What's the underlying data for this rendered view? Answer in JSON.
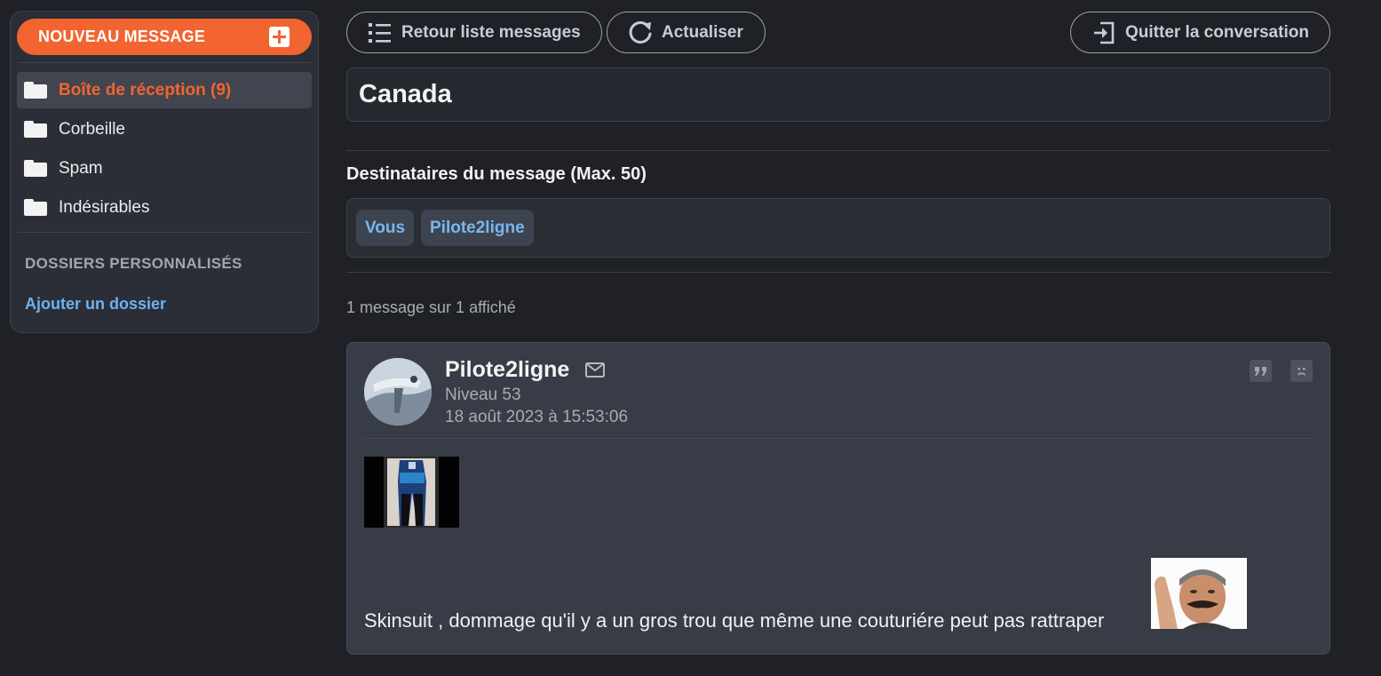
{
  "sidebar": {
    "new_message_label": "NOUVEAU MESSAGE",
    "folders": [
      {
        "label": "Boîte de réception (9)",
        "active": true
      },
      {
        "label": "Corbeille",
        "active": false
      },
      {
        "label": "Spam",
        "active": false
      },
      {
        "label": "Indésirables",
        "active": false
      }
    ],
    "custom_heading": "DOSSIERS PERSONNALISÉS",
    "add_folder_label": "Ajouter un dossier"
  },
  "toolbar": {
    "back_label": "Retour liste messages",
    "refresh_label": "Actualiser",
    "leave_label": "Quitter la conversation"
  },
  "conversation": {
    "subject": "Canada",
    "recipients_title": "Destinataires du message (Max. 50)",
    "recipients": [
      "Vous",
      "Pilote2ligne"
    ],
    "message_count": "1 message sur 1 affiché"
  },
  "message": {
    "author": "Pilote2ligne",
    "level": "Niveau 53",
    "date": "18 août 2023 à 15:53:06",
    "text": "Skinsuit , dommage qu'il y a un gros trou que même une couturiére peut pas rattraper"
  },
  "colors": {
    "accent": "#f26430",
    "link": "#6fb2f0",
    "background": "#1f2127",
    "card": "#373c47"
  },
  "icons": [
    "plus-icon",
    "folder-icon",
    "list-icon",
    "refresh-icon",
    "exit-icon",
    "envelope-icon",
    "quote-icon",
    "frown-icon"
  ]
}
